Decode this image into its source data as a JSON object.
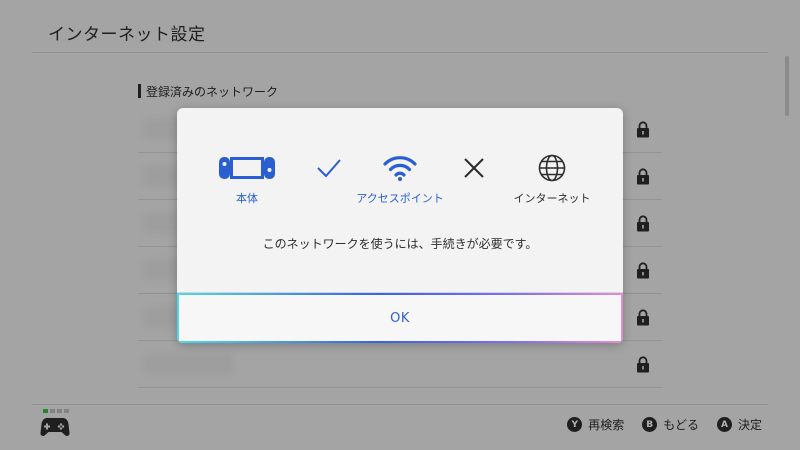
{
  "header": {
    "title": "インターネット設定"
  },
  "section": {
    "title": "登録済みのネットワーク"
  },
  "networks": [
    {
      "lock": "lock-icon"
    },
    {
      "lock": "lock-icon"
    },
    {
      "lock": "lock-icon"
    },
    {
      "lock": "lock-icon"
    },
    {
      "lock": "lock-icon"
    },
    {
      "lock": "lock-icon"
    }
  ],
  "dialog": {
    "steps": [
      {
        "icon": "switch-console-icon",
        "label": "本体"
      },
      {
        "icon": "checkmark-icon",
        "label": ""
      },
      {
        "icon": "wifi-icon",
        "label": "アクセスポイント"
      },
      {
        "icon": "cross-icon",
        "label": ""
      },
      {
        "icon": "globe-icon",
        "label": "インターネット"
      }
    ],
    "message": "このネットワークを使うには、手続きが必要です。",
    "ok_label": "OK"
  },
  "footer": {
    "actions": [
      {
        "button": "Y",
        "label": "再検索"
      },
      {
        "button": "B",
        "label": "もどる"
      },
      {
        "button": "A",
        "label": "決定"
      }
    ]
  },
  "colors": {
    "accent": "#2a5fd1",
    "background": "#ebebeb",
    "player_indicator": "#2ec43a"
  }
}
